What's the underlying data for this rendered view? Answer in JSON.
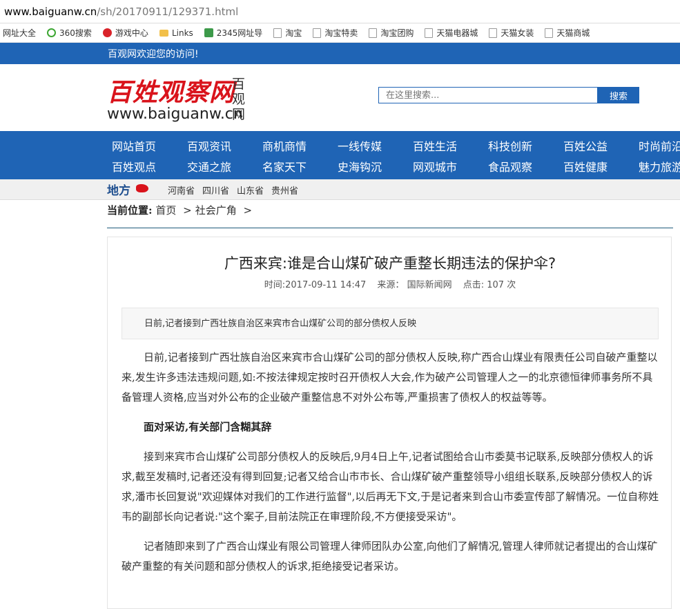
{
  "browser": {
    "url_host": "www.baiguanw.cn",
    "url_path": "/sh/20170911/129371.html",
    "bookmarks": [
      {
        "label": "网址大全",
        "icon": "page-icon"
      },
      {
        "label": "360搜索",
        "icon": "360-icon"
      },
      {
        "label": "游戏中心",
        "icon": "game-icon"
      },
      {
        "label": "Links",
        "icon": "folder-icon"
      },
      {
        "label": "2345网址导",
        "icon": "2345-icon"
      },
      {
        "label": "淘宝",
        "icon": "page-icon"
      },
      {
        "label": "淘宝特卖",
        "icon": "page-icon"
      },
      {
        "label": "淘宝团购",
        "icon": "page-icon"
      },
      {
        "label": "天猫电器城",
        "icon": "page-icon"
      },
      {
        "label": "天猫女装",
        "icon": "page-icon"
      },
      {
        "label": "天猫商城",
        "icon": "page-icon"
      }
    ]
  },
  "topbar": {
    "welcome": "百观网欢迎您的访问!"
  },
  "header": {
    "logo_text": "百姓观察网",
    "logo_side": "百观网",
    "logo_domain": "www.baiguanw.cn",
    "search_placeholder": "在这里搜索...",
    "search_button": "搜索"
  },
  "nav": {
    "row1": [
      "网站首页",
      "百观资讯",
      "商机商情",
      "一线传媒",
      "百姓生活",
      "科技创新",
      "百姓公益",
      "时尚前沿"
    ],
    "row2": [
      "百姓观点",
      "交通之旅",
      "名家天下",
      "史海钩沉",
      "网观城市",
      "食品观察",
      "百姓健康",
      "魅力旅游"
    ]
  },
  "local": {
    "label": "地方",
    "provinces": [
      "河南省",
      "四川省",
      "山东省",
      "贵州省"
    ]
  },
  "breadcrumb": {
    "label": "当前位置:",
    "home": "首页",
    "category": "社会广角",
    "sep": ">"
  },
  "article": {
    "title": "广西来宾:谁是合山煤矿破产重整长期违法的保护伞?",
    "time": "时间:2017-09-11 14:47",
    "source_label": "来源：",
    "source": "国际新闻网",
    "clicks_label": "点击:",
    "clicks": "107",
    "clicks_unit": "次",
    "summary": "日前,记者接到广西壮族自治区来宾市合山煤矿公司的部分债权人反映",
    "paragraphs": [
      "日前,记者接到广西壮族自治区来宾市合山煤矿公司的部分债权人反映,称广西合山煤业有限责任公司自破产重整以来,发生许多违法违规问题,如:不按法律规定按时召开债权人大会,作为破产公司管理人之一的北京德恒律师事务所不具备管理人资格,应当对外公布的企业破产重整信息不对外公布等,严重损害了债权人的权益等等。",
      "面对采访,有关部门含糊其辞",
      "接到来宾市合山煤矿公司部分债权人的反映后,9月4日上午,记者试图给合山市委莫书记联系,反映部分债权人的诉求,截至发稿时,记者还没有得到回复;记者又给合山市市长、合山煤矿破产重整领导小组组长联系,反映部分债权人的诉求,潘市长回复说\"欢迎媒体对我们的工作进行监督\",以后再无下文,于是记者来到合山市委宣传部了解情况。一位自称姓韦的副部长向记者说:\"这个案子,目前法院正在审理阶段,不方便接受采访\"。",
      "记者随即来到了广西合山煤业有限公司管理人律师团队办公室,向他们了解情况,管理人律师就记者提出的合山煤矿破产重整的有关问题和部分债权人的诉求,拒绝接受记者采访。"
    ]
  }
}
